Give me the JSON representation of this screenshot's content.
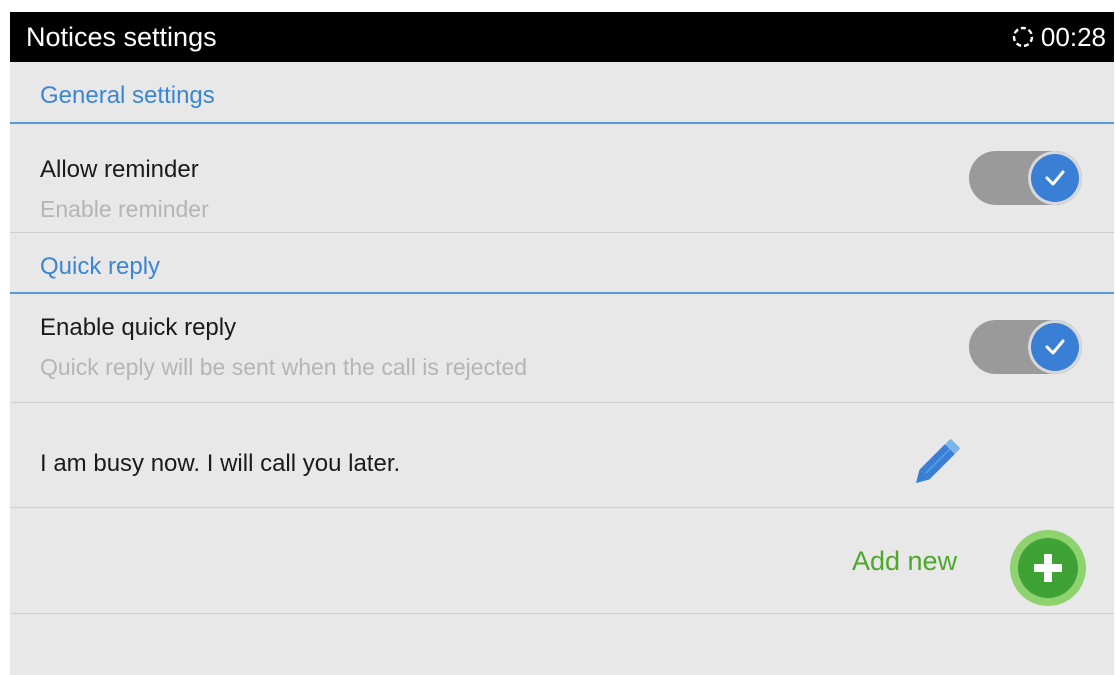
{
  "titlebar": {
    "title": "Notices settings",
    "time": "00:28",
    "sync_icon": "sync-icon"
  },
  "general": {
    "header": "General settings",
    "allow_reminder": {
      "title": "Allow reminder",
      "summary": "Enable reminder",
      "checked": true
    }
  },
  "quick_reply": {
    "header": "Quick reply",
    "enable": {
      "title": "Enable quick reply",
      "summary": "Quick reply will be sent when the call is rejected",
      "checked": true
    },
    "messages": [
      {
        "text": "I am busy now. I will call you later.",
        "icon": "pencil-icon"
      }
    ],
    "add_new_label": "Add new",
    "add_icon": "plus-icon"
  },
  "colors": {
    "accent_blue": "#3b86d3",
    "toggle_on": "#3a7fd6",
    "add_green": "#4ea82b",
    "titlebar_bg": "#000000"
  }
}
